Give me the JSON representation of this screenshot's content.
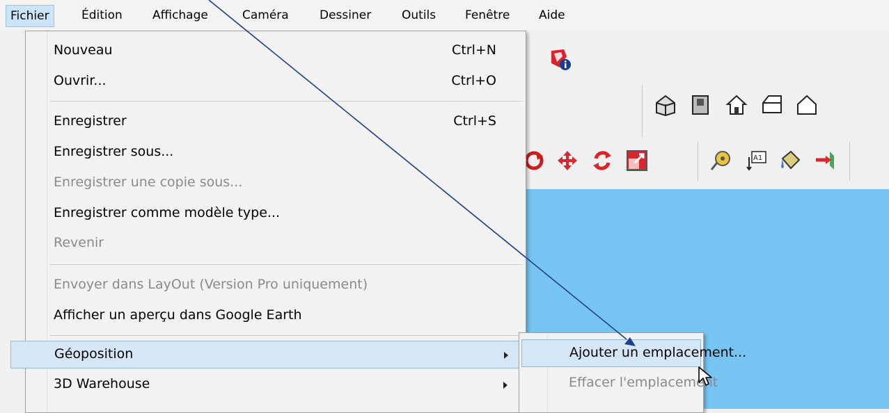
{
  "menubar": {
    "items": [
      {
        "label": "Fichier",
        "active": true
      },
      {
        "label": "Édition"
      },
      {
        "label": "Affichage"
      },
      {
        "label": "Caméra"
      },
      {
        "label": "Dessiner"
      },
      {
        "label": "Outils"
      },
      {
        "label": "Fenêtre"
      },
      {
        "label": "Aide"
      }
    ]
  },
  "file_menu": {
    "items": [
      {
        "label": "Nouveau",
        "shortcut": "Ctrl+N"
      },
      {
        "label": "Ouvrir...",
        "shortcut": "Ctrl+O"
      },
      {
        "label": "Enregistrer",
        "shortcut": "Ctrl+S"
      },
      {
        "label": "Enregistrer sous..."
      },
      {
        "label": "Enregistrer une copie sous...",
        "disabled": true
      },
      {
        "label": "Enregistrer comme modèle type..."
      },
      {
        "label": "Revenir",
        "disabled": true
      },
      {
        "label": "Envoyer dans LayOut (Version Pro uniquement)",
        "disabled": true
      },
      {
        "label": "Afficher un aperçu dans Google Earth"
      },
      {
        "label": "Géoposition",
        "submenu": true,
        "highlighted": true
      },
      {
        "label": "3D Warehouse",
        "submenu": true
      }
    ]
  },
  "geoposition_submenu": {
    "items": [
      {
        "label": "Ajouter un emplacement...",
        "highlighted": true
      },
      {
        "label": "Effacer l'emplacement",
        "disabled": true
      }
    ]
  },
  "toolbar": {
    "icons": [
      "model-info-icon",
      "iso-view-icon",
      "top-view-icon",
      "front-view-icon",
      "right-view-icon",
      "back-view-icon",
      "orbit-icon",
      "move-icon",
      "rotate-icon",
      "scale-icon",
      "tape-measure-icon",
      "text-label-icon",
      "paint-bucket-icon",
      "section-plane-icon"
    ]
  },
  "colors": {
    "viewport_sky": "#76c4f2",
    "menu_highlight": "#d5e6f7",
    "annotation_arrow": "#1f3f8a"
  }
}
